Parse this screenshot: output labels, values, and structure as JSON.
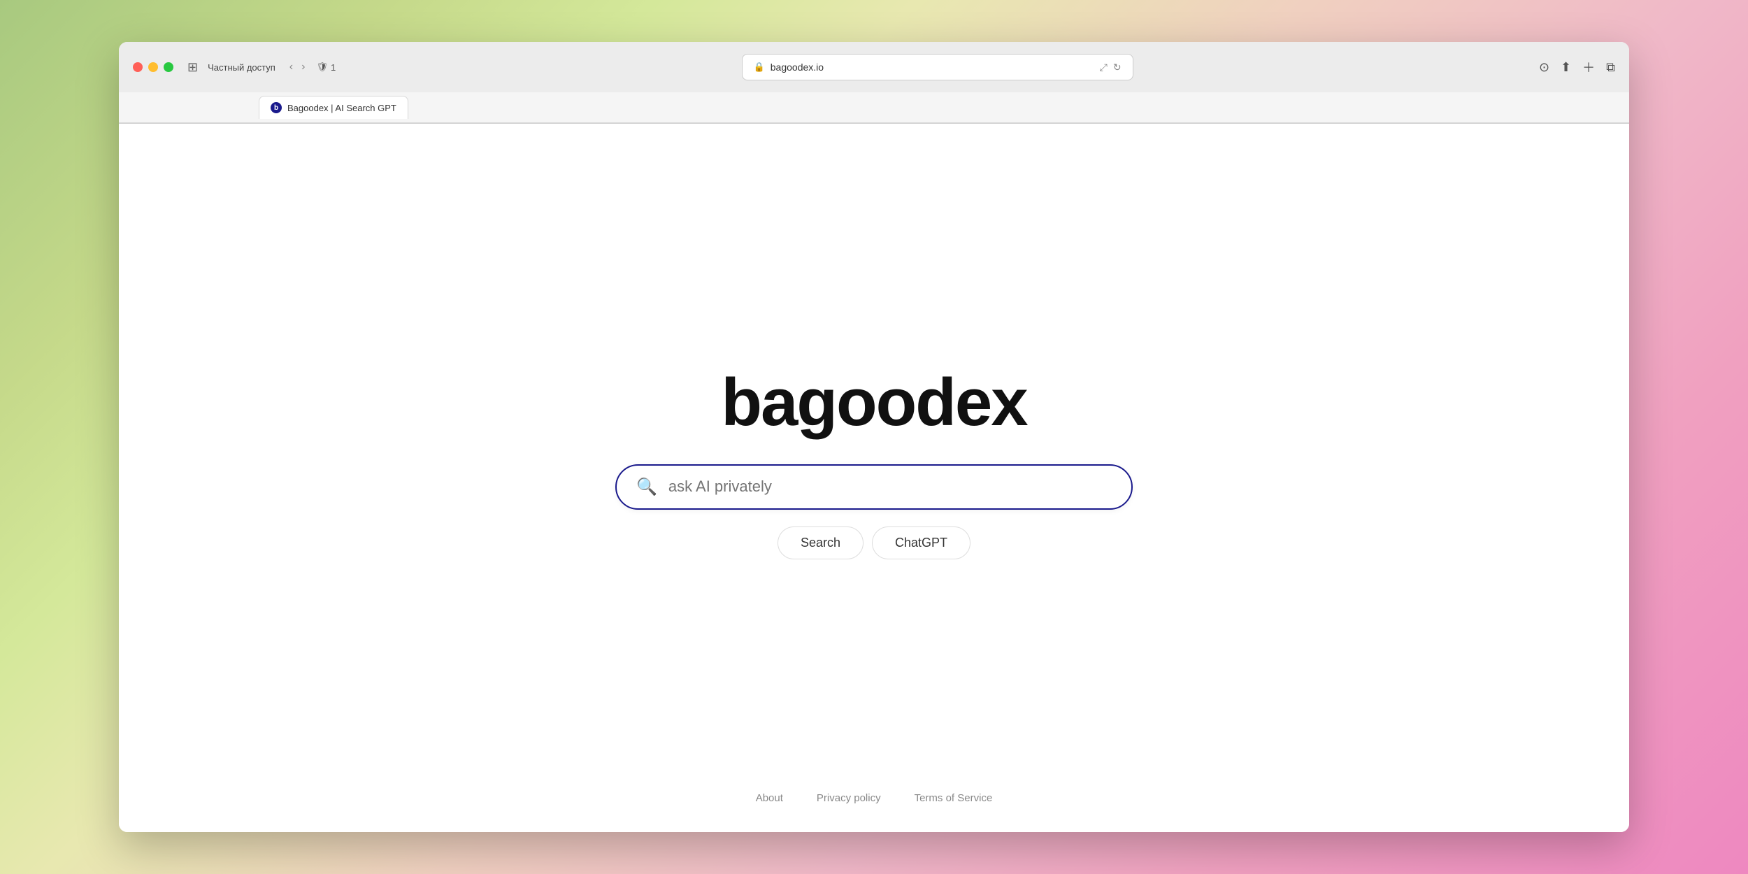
{
  "browser": {
    "traffic_lights": {
      "red": "red",
      "yellow": "yellow",
      "green": "green"
    },
    "private_label": "Частный доступ",
    "shield_label": "1",
    "address": "bagoodex.io",
    "tab_title": "Bagoodex | AI Search GPT",
    "tab_favicon_letter": "b"
  },
  "page": {
    "logo": "bagoodex",
    "search_placeholder": "ask AI privately",
    "search_button_label": "Search",
    "chatgpt_button_label": "ChatGPT",
    "footer": {
      "about_label": "About",
      "privacy_label": "Privacy policy",
      "tos_label": "Terms of Service"
    }
  }
}
